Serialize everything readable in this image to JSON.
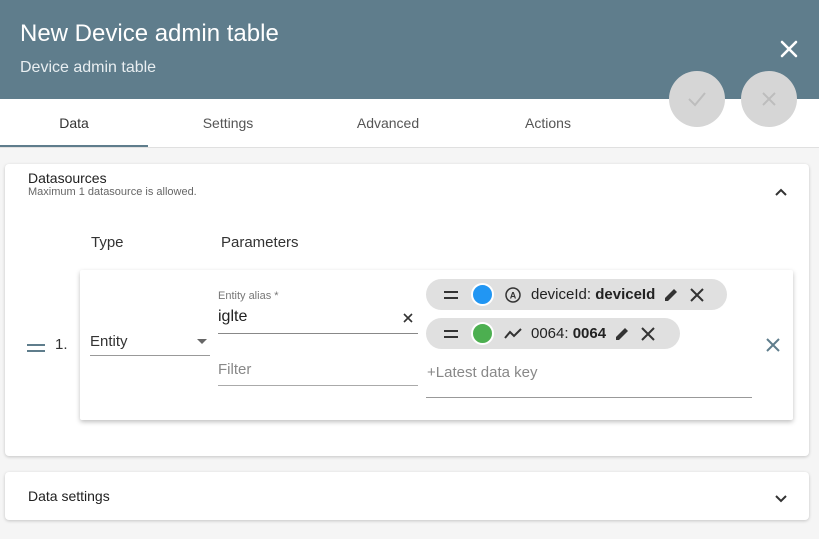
{
  "header": {
    "title": "New Device admin table",
    "subtitle": "Device admin table",
    "close_icon": "close-icon"
  },
  "tabs": [
    {
      "label": "Data"
    },
    {
      "label": "Settings"
    },
    {
      "label": "Advanced"
    },
    {
      "label": "Actions"
    }
  ],
  "fabs": {
    "apply_icon": "check-icon",
    "cancel_icon": "close-icon"
  },
  "datasources": {
    "title": "Datasources",
    "subtitle": "Maximum 1 datasource is allowed.",
    "col_type": "Type",
    "col_parameters": "Parameters",
    "row": {
      "index": "1.",
      "type": "Entity",
      "entity_alias_label": "Entity alias *",
      "entity_alias_value": "iglte",
      "filter_placeholder": "Filter",
      "latest_placeholder": "+Latest data key",
      "keys": [
        {
          "name": "deviceId",
          "label": "deviceId",
          "color": "#2196f3",
          "icon": "attribute-icon"
        },
        {
          "name": "0064",
          "label": "0064",
          "color": "#4caf50",
          "icon": "timeseries-icon"
        }
      ]
    }
  },
  "data_settings": {
    "title": "Data settings"
  },
  "colors": {
    "header": "#5f7d8c",
    "accent": "#5f7d8c"
  }
}
